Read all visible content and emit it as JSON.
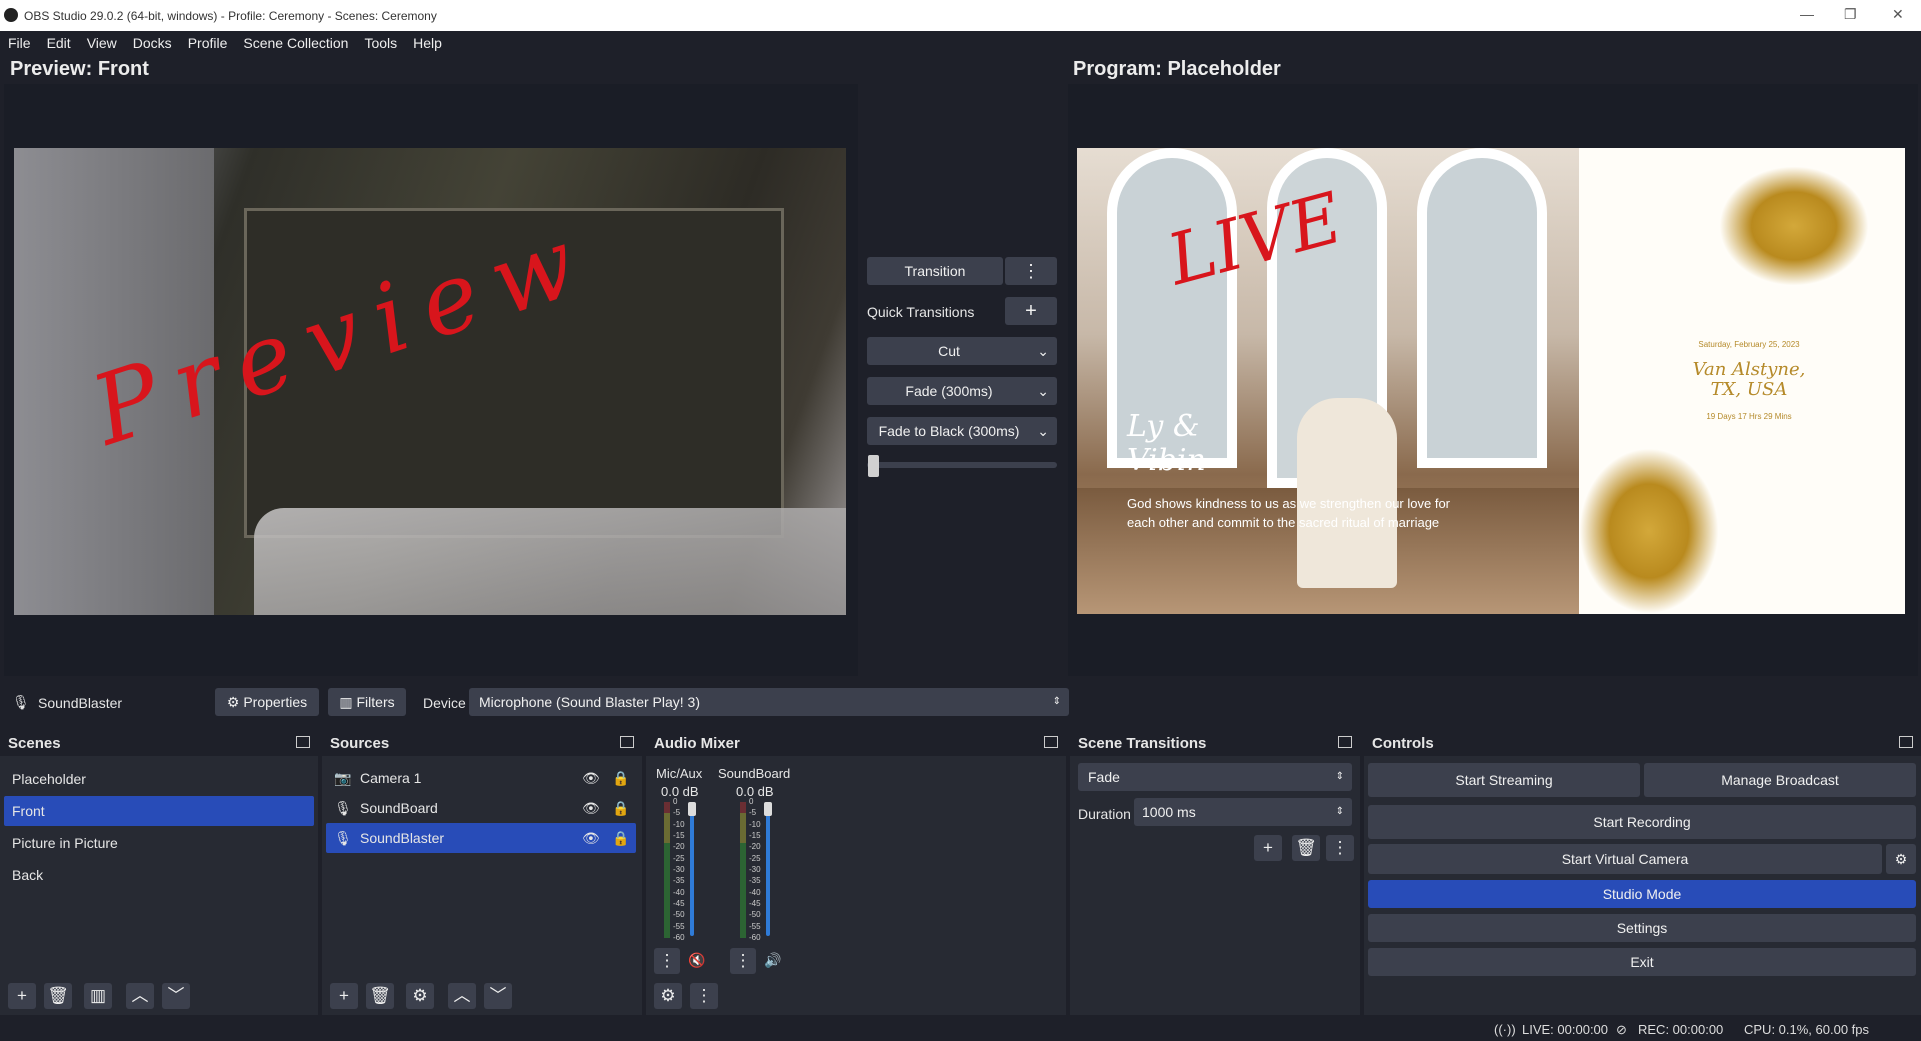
{
  "window": {
    "title": "OBS Studio 29.0.2 (64-bit, windows) - Profile: Ceremony - Scenes: Ceremony",
    "minimize": "—",
    "maximize": "❐",
    "close": "✕"
  },
  "menu": [
    "File",
    "Edit",
    "View",
    "Docks",
    "Profile",
    "Scene Collection",
    "Tools",
    "Help"
  ],
  "preview": {
    "header": "Preview: Front",
    "overlay_text": "Preview"
  },
  "program": {
    "header": "Program: Placeholder",
    "overlay_text": "LIVE",
    "names": "Ly & Vibin",
    "verse": "God shows kindness to us as we strengthen our love for each other and commit to the sacred ritual of marriage",
    "date": "Saturday, February 25, 2023",
    "location": "Van Alstyne, TX, USA",
    "countdown": "19 Days  17 Hrs  29 Mins"
  },
  "transitions_mid": {
    "transition_label": "Transition",
    "quick_label": "Quick Transitions",
    "items": [
      "Cut",
      "Fade (300ms)",
      "Fade to Black (300ms)"
    ],
    "tbar_value": 0
  },
  "propbar": {
    "source_name": "SoundBlaster",
    "properties_label": "Properties",
    "filters_label": "Filters",
    "device_label": "Device",
    "device_value": "Microphone (Sound Blaster Play! 3)"
  },
  "scenes": {
    "title": "Scenes",
    "items": [
      "Placeholder",
      "Front",
      "Picture in Picture",
      "Back"
    ],
    "selected": 1
  },
  "sources": {
    "title": "Sources",
    "items": [
      "Camera 1",
      "SoundBoard",
      "SoundBlaster"
    ],
    "selected": 2
  },
  "mixer": {
    "title": "Audio Mixer",
    "channels": [
      {
        "name": "Mic/Aux",
        "db": "0.0 dB",
        "muted": true,
        "fader": 1.0
      },
      {
        "name": "SoundBoard",
        "db": "0.0 dB",
        "muted": false,
        "fader": 1.0
      }
    ],
    "scale": [
      "0",
      "-5",
      "-10",
      "-15",
      "-20",
      "-25",
      "-30",
      "-35",
      "-40",
      "-45",
      "-50",
      "-55",
      "-60"
    ]
  },
  "scene_transitions": {
    "title": "Scene Transitions",
    "selected": "Fade",
    "duration_label": "Duration",
    "duration_value": "1000 ms"
  },
  "controls": {
    "title": "Controls",
    "start_streaming": "Start Streaming",
    "manage_broadcast": "Manage Broadcast",
    "start_recording": "Start Recording",
    "start_virtual_camera": "Start Virtual Camera",
    "studio_mode": "Studio Mode",
    "settings": "Settings",
    "exit": "Exit"
  },
  "status": {
    "live": "LIVE: 00:00:00",
    "rec": "REC: 00:00:00",
    "cpu": "CPU: 0.1%, 60.00 fps"
  },
  "colors": {
    "accent": "#284cb8",
    "panel": "#272a33",
    "bg": "#1e2029",
    "button": "#3c404d",
    "ink_red": "#d8151c"
  }
}
